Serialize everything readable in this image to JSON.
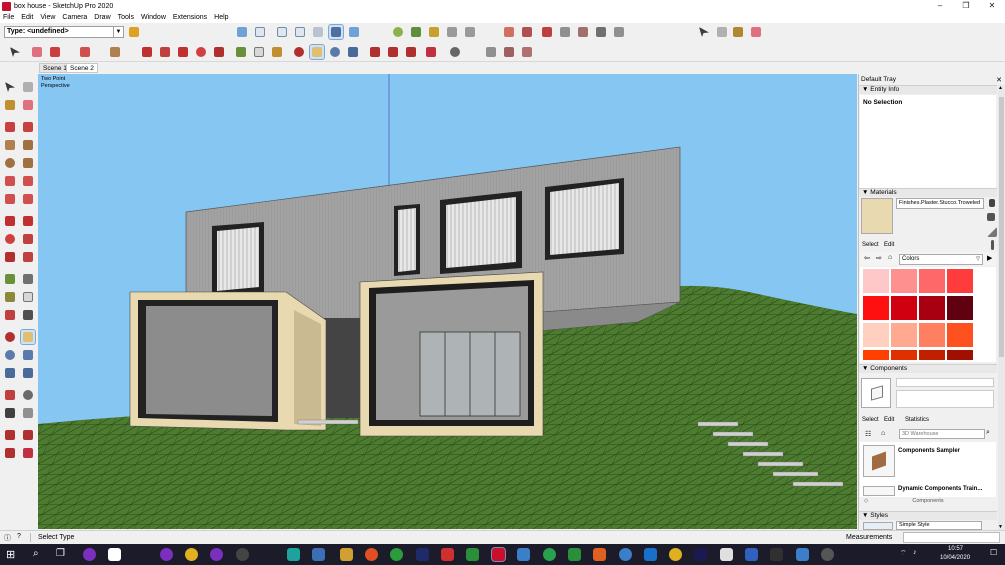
{
  "window": {
    "title": "box house - SketchUp Pro 2020"
  },
  "menu": [
    "File",
    "Edit",
    "View",
    "Camera",
    "Draw",
    "Tools",
    "Window",
    "Extensions",
    "Help"
  ],
  "toolbar": {
    "type_select": "Type: <undefined>"
  },
  "scenes": [
    {
      "label": "Scene 1",
      "active": false
    },
    {
      "label": "Scene 2",
      "active": true
    }
  ],
  "viewport": {
    "camera_label": "Two Point",
    "projection_label": "Perspective"
  },
  "tray": {
    "title": "Default Tray",
    "entity_info": {
      "header": "Entity Info",
      "selection": "No Selection"
    },
    "materials": {
      "header": "Materials",
      "material_name": "Finishes.Plaster.Stucco.Troweled",
      "tabs": [
        "Select",
        "Edit"
      ],
      "library": "Colors",
      "swatches": [
        "#ffc8c8",
        "#ff9090",
        "#ff6868",
        "#ff3c3c",
        "#ff1010",
        "#d00010",
        "#a80010",
        "#600010",
        "#ffd0c0",
        "#ffaa90",
        "#ff8060",
        "#ff5020",
        "#ff4000",
        "#e03000",
        "#c02000",
        "#a01000"
      ]
    },
    "components": {
      "header": "Components",
      "tabs": [
        "Select",
        "Edit",
        "Statistics"
      ],
      "search_placeholder": "3D Warehouse",
      "items": [
        "Components Sampler",
        "Dynamic Components Train..."
      ],
      "footer": "Components"
    },
    "styles": {
      "header": "Styles",
      "style_name": "Simple Style"
    }
  },
  "status": {
    "hint": "Select Type",
    "measurements_label": "Measurements"
  },
  "clock": {
    "time": "10:57",
    "date": "10/04/2020"
  },
  "colors": {
    "sky": "#86c6f2",
    "ground": "#4d7b2f",
    "wall": "#9d9d9d",
    "frame": "#e9d9b0",
    "panel_bg": "#f0f0f0",
    "taskbar": "#1b1b2a"
  }
}
